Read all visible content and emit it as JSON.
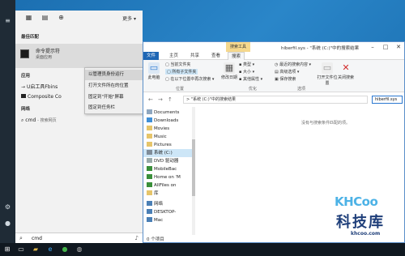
{
  "search_panel": {
    "more_label": "更多",
    "section_best": "最佳匹配",
    "best_title": "命令提示符",
    "best_sub": "桌面应用",
    "section_apps": "应用",
    "app1": "U启工具Fbins",
    "app2": "Composite Co",
    "section_web": "网络",
    "web1": "cmd",
    "web1_sub": "- 搜索网页",
    "query": "cmd"
  },
  "context_menu": {
    "items": [
      "以管理员身份运行",
      "打开文件所在的位置",
      "固定到\"开始\"屏幕",
      "固定到任务栏"
    ]
  },
  "explorer": {
    "context_tab": "搜索工具",
    "window_title": "hiberfil.sys - \"系统 (C:)\"中的搜索结果",
    "tabs": [
      "文件",
      "主页",
      "共享",
      "查看",
      "搜索"
    ],
    "ribbon": {
      "this_pc": "此电脑",
      "current_folder": "当前文件夹",
      "all_subfolders": "所有子文件夹",
      "search_again": "在以下位置中再次搜索",
      "modified": "修改日期",
      "kind": "类型",
      "size": "大小",
      "other_props": "其他属性",
      "recent": "最近的搜索内容",
      "advanced": "高级选项",
      "save_search": "保存搜索",
      "open_location": "打开文件位置",
      "close_search": "关闭搜索",
      "grp_location": "位置",
      "grp_refine": "优化",
      "grp_options": "选项"
    },
    "address": "> \"系统 (C:)\"中的搜索结果",
    "search_box": "hiberfil.sys",
    "empty_message": "没有与搜索条件匹配的项。",
    "nav_items": [
      "Documents",
      "Downloads",
      "Movies",
      "Music",
      "Pictures",
      "系统 (C:)",
      "DVD 驱动器",
      "MobileBac",
      "Home on 'M",
      "AllFiles on",
      "库",
      "网络",
      "DESKTOP-",
      "Mac"
    ],
    "status": "0 个项目"
  },
  "watermark": {
    "logo": "KHCoo",
    "cn": "科技库",
    "url": "khcoo.com"
  }
}
